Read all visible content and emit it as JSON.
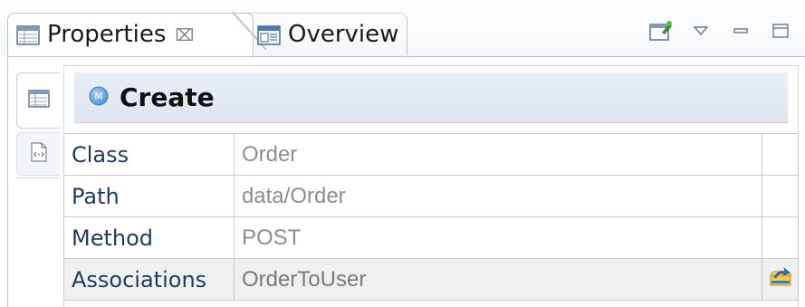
{
  "tabs": [
    {
      "label": "Properties",
      "active": true,
      "close_glyph": "⌧"
    },
    {
      "label": "Overview",
      "active": false
    }
  ],
  "view_toolbar": {
    "icons": [
      "pin-to-editor-icon",
      "view-menu-icon",
      "minimize-icon",
      "maximize-icon"
    ]
  },
  "side_tabs": [
    "table-view-icon",
    "xml-source-icon"
  ],
  "header": {
    "badge": "M",
    "title": "Create"
  },
  "properties": [
    {
      "key": "Class",
      "value": "Order",
      "has_action": false
    },
    {
      "key": "Path",
      "value": "data/Order",
      "has_action": false
    },
    {
      "key": "Method",
      "value": "POST",
      "has_action": false
    },
    {
      "key": "Associations",
      "value": "OrderToUser",
      "has_action": true
    }
  ],
  "colors": {
    "accent": "#5b9bd5",
    "header_bg": "#e3eaf2",
    "value_text": "#8e8e8e",
    "key_text": "#1f3a5c"
  }
}
